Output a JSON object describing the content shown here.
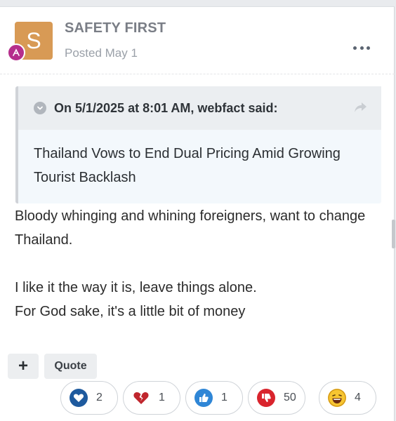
{
  "post": {
    "author": "SAFETY FIRST",
    "avatar_letter": "S",
    "avatar_color": "#d89a55",
    "badge_color": "#b52e8c",
    "posted": "Posted May 1"
  },
  "quote": {
    "cite": "On 5/1/2025 at 8:01 AM, webfact said:",
    "text": "Thailand Vows to End Dual Pricing Amid Growing Tourist Backlash"
  },
  "content": {
    "p1": "Bloody whinging and whining foreigners, want to change Thailand.",
    "p2": "I like it the way it is, leave things alone.",
    "p3": "For God sake, it's a little bit of money"
  },
  "actions": {
    "add_label": "+",
    "quote_label": "Quote"
  },
  "reactions": [
    {
      "icon": "heart-icon",
      "count": "2",
      "color": "#1e5a9e"
    },
    {
      "icon": "broken-heart-icon",
      "count": "1",
      "color": "#c0262d"
    },
    {
      "icon": "thumbs-up-icon",
      "count": "1",
      "color": "#2f86d6"
    },
    {
      "icon": "thumbs-down-icon",
      "count": "50",
      "color": "#d9242d"
    },
    {
      "icon": "laughing-face-icon",
      "count": "4",
      "color": "#f2b925"
    }
  ]
}
